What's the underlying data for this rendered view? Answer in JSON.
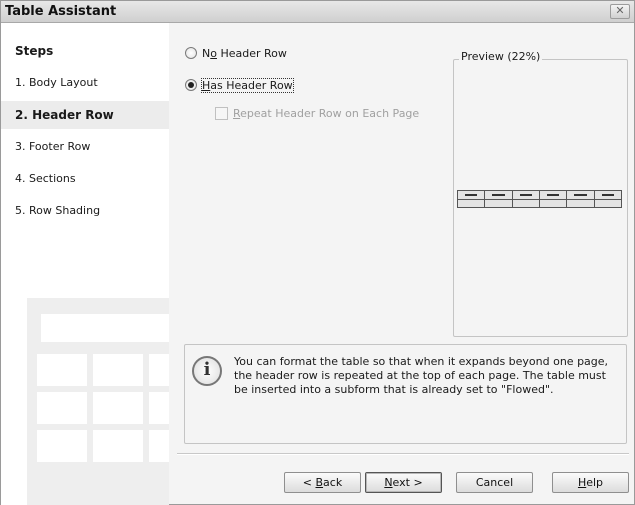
{
  "window": {
    "title": "Table Assistant",
    "close_glyph": "✕"
  },
  "steps": {
    "title": "Steps",
    "items": [
      {
        "label": "1. Body Layout"
      },
      {
        "label": "2. Header Row",
        "active": true
      },
      {
        "label": "3. Footer Row"
      },
      {
        "label": "4. Sections"
      },
      {
        "label": "5. Row Shading"
      }
    ]
  },
  "options": {
    "no_header": {
      "pre": "N",
      "mn": "o",
      "post": " Header Row",
      "checked": false
    },
    "has_header": {
      "pre": "",
      "mn": "H",
      "post": "as Header Row",
      "checked": true
    },
    "repeat_header": {
      "pre": "",
      "mn": "R",
      "post": "epeat Header Row on Each Page",
      "checked": false,
      "disabled": true
    }
  },
  "preview": {
    "label": "Preview (22%)",
    "columns": 6
  },
  "info": {
    "icon": "info-icon",
    "text": "You can format the table so that when it expands beyond one page, the header row is repeated at the top of each page. The table must be inserted into a subform that is already set to \"Flowed\"."
  },
  "buttons": {
    "back": {
      "pre": "< ",
      "mn": "B",
      "post": "ack"
    },
    "next": {
      "pre": "",
      "mn": "N",
      "post": "ext >"
    },
    "cancel": {
      "label": "Cancel"
    },
    "help": {
      "pre": "",
      "mn": "H",
      "post": "elp"
    }
  }
}
